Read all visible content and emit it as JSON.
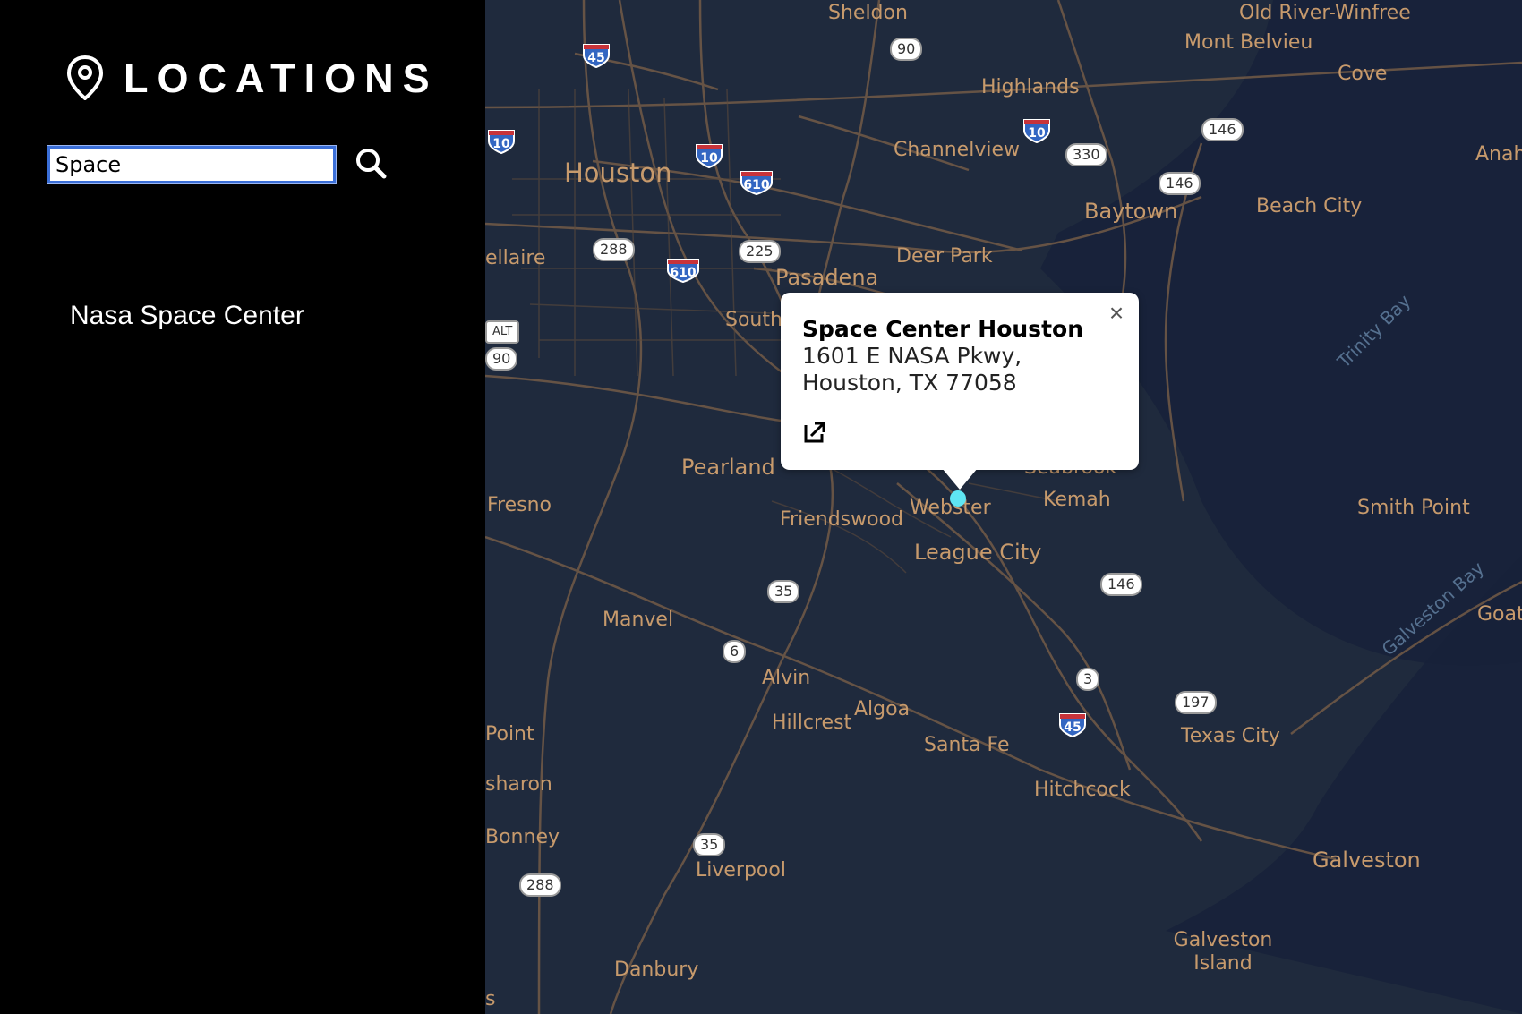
{
  "sidebar": {
    "title": "LOCATIONS",
    "title_icon": "map-pin-icon",
    "search": {
      "value": "Space",
      "placeholder": ""
    },
    "search_icon": "search-icon",
    "results": [
      {
        "label": "Nasa Space Center"
      }
    ]
  },
  "map": {
    "colors": {
      "background": "#1f2a3d",
      "roads": "#8a6d52",
      "labels": "#c79a6c",
      "marker": "#5fe6f2"
    },
    "places": [
      "Sheldon",
      "Old River-Winfree",
      "Mont Belvieu",
      "Cove",
      "Highlands",
      "Channelview",
      "Houston",
      "Baytown",
      "Beach City",
      "Anah",
      "ellaire",
      "Deer Park",
      "Pasadena",
      "South",
      "Pearland",
      "Seabrook",
      "Kemah",
      "Webster",
      "Friendswood",
      "League City",
      "Smith Point",
      "Fresno",
      "Manvel",
      "Alvin",
      "Algoa",
      "Hillcrest",
      "Santa Fe",
      "Texas City",
      "Point",
      "sharon",
      "Hitchcock",
      "Galveston",
      "Bonney",
      "Liverpool",
      "Galveston Island",
      "Danbury",
      "Goat",
      "s"
    ],
    "water_labels": [
      "Trinity Bay",
      "Galveston Bay"
    ],
    "road_shields": [
      "90",
      "146",
      "330",
      "146",
      "288",
      "225",
      "35",
      "146",
      "6",
      "3",
      "197",
      "35",
      "288",
      "ALT",
      "90"
    ],
    "interstates": [
      "45",
      "10",
      "10",
      "610",
      "10",
      "610",
      "45"
    ]
  },
  "popup": {
    "title": "Space Center Houston",
    "address": "1601 E NASA Pkwy, Houston, TX 77058",
    "close_label": "×",
    "link_icon": "open-external-icon"
  }
}
